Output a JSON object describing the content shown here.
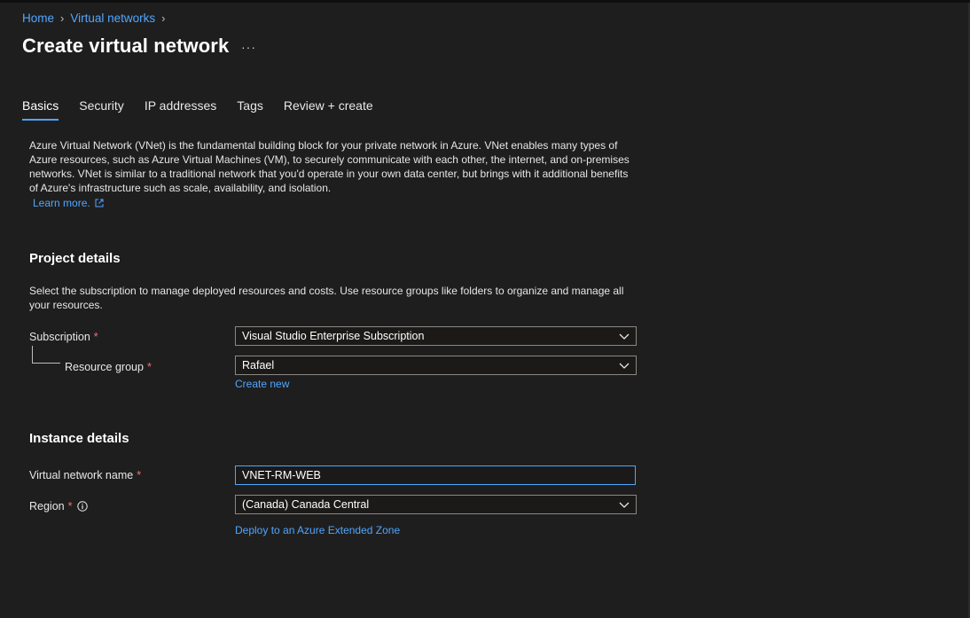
{
  "breadcrumb": {
    "items": [
      "Home",
      "Virtual networks"
    ]
  },
  "header": {
    "title": "Create virtual network",
    "more": "···"
  },
  "tabs": [
    {
      "label": "Basics",
      "active": true
    },
    {
      "label": "Security",
      "active": false
    },
    {
      "label": "IP addresses",
      "active": false
    },
    {
      "label": "Tags",
      "active": false
    },
    {
      "label": "Review + create",
      "active": false
    }
  ],
  "intro": {
    "text": "Azure Virtual Network (VNet) is the fundamental building block for your private network in Azure. VNet enables many types of Azure resources, such as Azure Virtual Machines (VM), to securely communicate with each other, the internet, and on-premises networks. VNet is similar to a traditional network that you'd operate in your own data center, but brings with it additional benefits of Azure's infrastructure such as scale, availability, and isolation.",
    "learn_more": "Learn more."
  },
  "project": {
    "title": "Project details",
    "description": "Select the subscription to manage deployed resources and costs. Use resource groups like folders to organize and manage all your resources.",
    "subscription_label": "Subscription",
    "subscription_value": "Visual Studio Enterprise Subscription",
    "resource_group_label": "Resource group",
    "resource_group_value": "Rafael",
    "create_new": "Create new"
  },
  "instance": {
    "title": "Instance details",
    "vnet_name_label": "Virtual network name",
    "vnet_name_value": "VNET-RM-WEB",
    "region_label": "Region",
    "region_value": "(Canada) Canada Central",
    "extended_zone_link": "Deploy to an Azure Extended Zone"
  },
  "required_marker": "*",
  "colors": {
    "accent": "#4fa6ff",
    "required": "#f1707b",
    "background": "#1f1e1e"
  }
}
